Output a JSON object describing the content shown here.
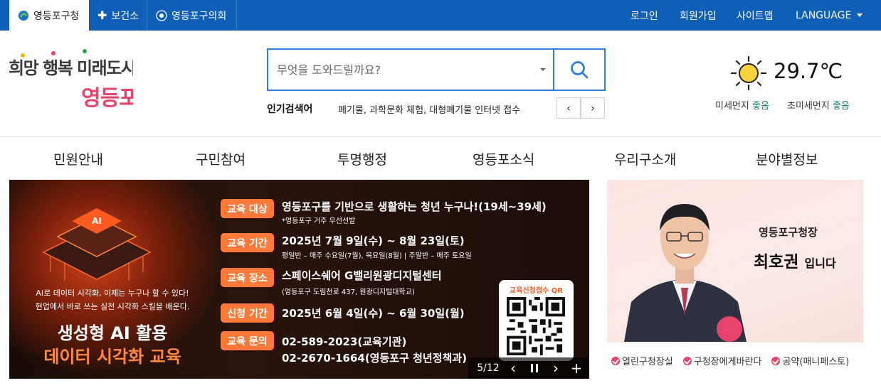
{
  "top_tabs": [
    {
      "label": "영등포구청",
      "icon": "district-logo-icon"
    },
    {
      "label": "보건소",
      "icon": "plus-icon"
    },
    {
      "label": "영등포구의회",
      "icon": "council-emblem-icon"
    }
  ],
  "top_links": {
    "login": "로그인",
    "signup": "회원가입",
    "sitemap": "사이트맵",
    "language": "LANGUAGE"
  },
  "logo": {
    "slogan": "희망 행복 미래도시",
    "name": "영등포"
  },
  "search": {
    "placeholder": "무엇을 도와드릴까요?"
  },
  "popular": {
    "label": "인기검색어",
    "terms": "폐기물, 과학문화 체험, 대형폐기물 인터넷 접수"
  },
  "weather": {
    "temp": "29.7℃",
    "pm10_label": "미세먼지",
    "pm10_status": "좋음",
    "pm25_label": "초미세먼지",
    "pm25_status": "좋음",
    "icon": "sun-icon"
  },
  "gnb": [
    "민원안내",
    "구민참여",
    "투명행정",
    "영등포소식",
    "우리구소개",
    "분야별정보"
  ],
  "banner": {
    "sub1": "AI로 데이터 시각화, 이제는 누구나 할 수 있다!",
    "sub2": "현업에서 바로 쓰는 실전 시각화 스킬을 배운다.",
    "title1": "생성형 AI 활용",
    "title2": "데이터 시각화 교육",
    "rows": [
      {
        "tag": "교육 대상",
        "main": "영등포구를 기반으로 생활하는 청년 누구나!(19세~39세)",
        "sub": "*영등포구 거주 우선선발"
      },
      {
        "tag": "교육 기간",
        "main": "2025년 7월 9일(수) ~ 8월 23일(토)",
        "sub": "평일반 – 매주 수요일(7월), 목요일(8월) | 주말반 – 매주 토요일"
      },
      {
        "tag": "교육 장소",
        "main": "스페이스쉐어 G밸리원광디지털센터",
        "sub": "(영등포구 도림천로 437, 원광디지털대학교)"
      },
      {
        "tag": "신청 기간",
        "main": "2025년 6월 4일(수) ~ 6월 30일(월)",
        "sub": ""
      },
      {
        "tag": "교육 문의",
        "main": "02-589-2023(교육기관)",
        "sub": "02-2670-1664(영등포구 청년정책과)"
      }
    ],
    "qr_label": "교육신청접수 QR",
    "counter": "5/12"
  },
  "mayor": {
    "title": "영등포구청장",
    "name": "최호권",
    "suffix": "입니다",
    "links": [
      "열린구청장실",
      "구청장에게바란다",
      "공약(매니페스토)"
    ]
  },
  "colors": {
    "topbar": "#0f5fb8",
    "accent_blue": "#2f7ed8",
    "tag_orange": "#ff7a3a",
    "good_green": "#14806b",
    "logo_pink": "#e8436c"
  }
}
